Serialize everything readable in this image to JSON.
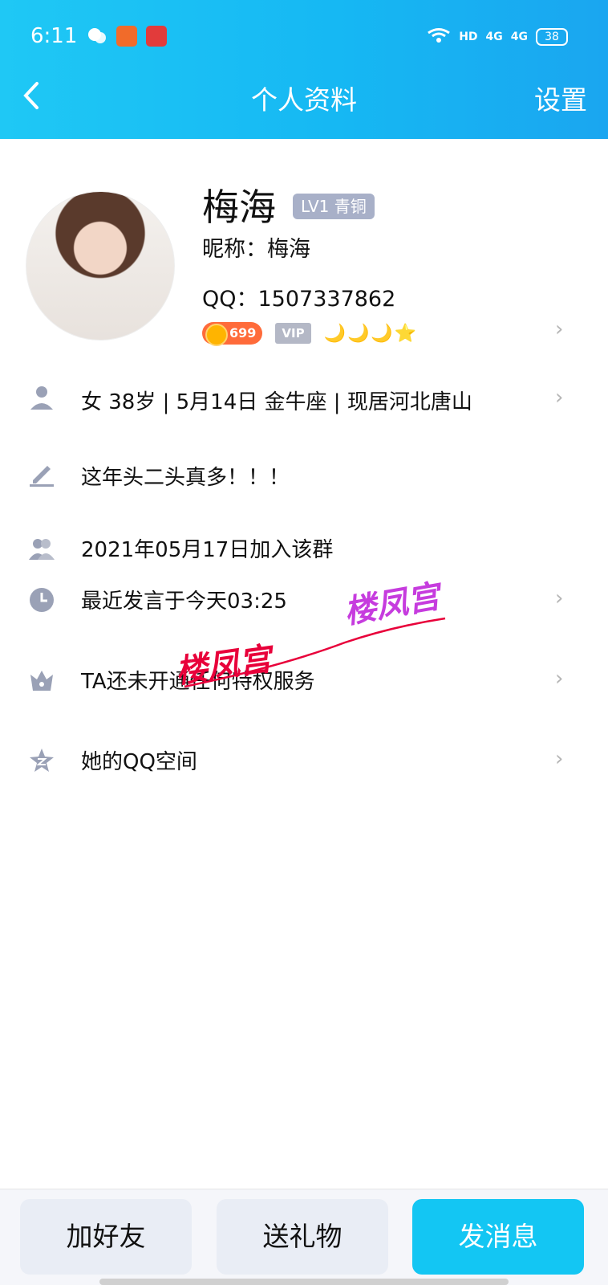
{
  "status_bar": {
    "time": "6:11",
    "network_labels": [
      "HD",
      "4G",
      "4G"
    ],
    "battery": "38"
  },
  "nav": {
    "title": "个人资料",
    "settings_label": "设置"
  },
  "profile": {
    "name": "梅海",
    "level_badge": "LV1 青铜",
    "nickname_label": "昵称：梅海",
    "qq_label": "QQ：1507337862",
    "coin_value": "699",
    "vip_label": "VIP",
    "level_icons": "🌙🌙🌙⭐"
  },
  "rows": [
    {
      "icon": "person-icon",
      "text": "女  38岁  |  5月14日  金牛座  |  现居河北唐山",
      "has_chevron": true
    },
    {
      "icon": "pencil-icon",
      "text": "这年头二头真多！！！",
      "has_chevron": false
    },
    {
      "icon": "group-icon",
      "text": "2021年05月17日加入该群",
      "has_chevron": false
    },
    {
      "icon": "clock-icon",
      "text": "最近发言于今天03:25",
      "has_chevron": true
    },
    {
      "icon": "crown-icon",
      "text": "TA还未开通任何特权服务",
      "has_chevron": true
    },
    {
      "icon": "qzone-star-icon",
      "text": "她的QQ空间",
      "has_chevron": true
    }
  ],
  "watermarks": [
    "楼凤宫",
    "楼凤宫"
  ],
  "actions": {
    "add_friend": "加好友",
    "send_gift": "送礼物",
    "send_message": "发消息"
  },
  "colors": {
    "header": "#16b8f3",
    "primary_button": "#13c6f3",
    "secondary_button": "#e9edf5"
  }
}
